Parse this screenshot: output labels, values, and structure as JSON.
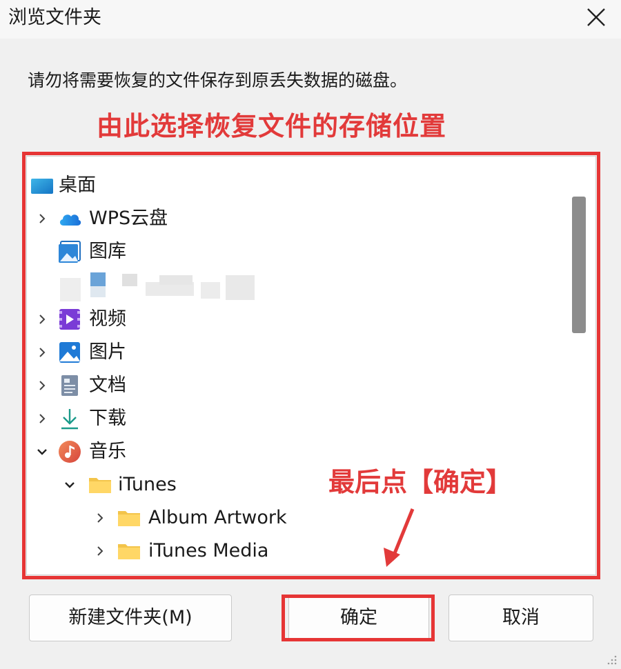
{
  "window": {
    "title": "浏览文件夹",
    "close_icon": "close-icon"
  },
  "instruction": "请勿将需要恢复的文件保存到原丢失数据的磁盘。",
  "annotations": {
    "select_location": "由此选择恢复文件的存储位置",
    "click_confirm": "最后点【确定】",
    "highlight_color": "#e63535"
  },
  "tree": {
    "items": [
      {
        "label": "桌面",
        "icon": "desktop-icon",
        "expanded": null
      },
      {
        "label": "WPS云盘",
        "icon": "cloud-icon",
        "expanded": false
      },
      {
        "label": "图库",
        "icon": "gallery-icon",
        "expanded": null
      },
      {
        "label": "",
        "icon": "blurred-item-icon",
        "expanded": null
      },
      {
        "label": "视频",
        "icon": "videos-icon",
        "expanded": false
      },
      {
        "label": "图片",
        "icon": "pictures-icon",
        "expanded": false
      },
      {
        "label": "文档",
        "icon": "documents-icon",
        "expanded": false
      },
      {
        "label": "下载",
        "icon": "downloads-icon",
        "expanded": false
      },
      {
        "label": "音乐",
        "icon": "music-icon",
        "expanded": true
      },
      {
        "label": "iTunes",
        "icon": "folder-icon",
        "expanded": true
      },
      {
        "label": "Album Artwork",
        "icon": "folder-icon",
        "expanded": false
      },
      {
        "label": "iTunes Media",
        "icon": "folder-icon",
        "expanded": false
      }
    ]
  },
  "buttons": {
    "new_folder": "新建文件夹(M)",
    "ok": "确定",
    "cancel": "取消"
  }
}
